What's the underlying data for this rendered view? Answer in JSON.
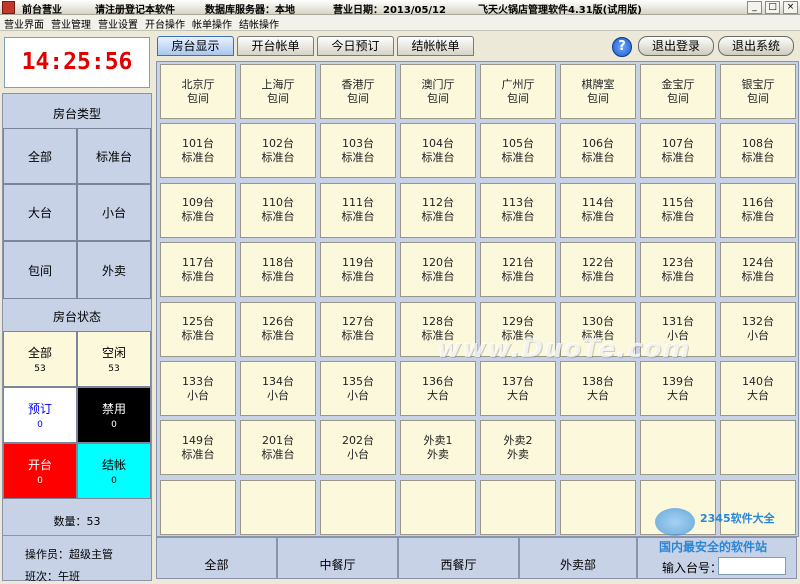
{
  "titlebar": {
    "module": "前台营业",
    "register": "请注册登记本软件",
    "db_server": "数据库服务器：本地",
    "business_date": "营业日期：2013/05/12",
    "app_title": "飞天火锅店管理软件4.31版(试用版)"
  },
  "menu": [
    "营业界面",
    "营业管理",
    "营业设置",
    "开台操作",
    "帐单操作",
    "结帐操作"
  ],
  "clock": "14:25:56",
  "room_types": {
    "heading": "房台类型",
    "items": [
      "全部",
      "标准台",
      "大台",
      "小台",
      "包间",
      "外卖"
    ]
  },
  "room_status": {
    "heading": "房台状态",
    "items": [
      {
        "label": "全部",
        "count": "53",
        "bg": "#fbf8dc",
        "fg": "#000000"
      },
      {
        "label": "空闲",
        "count": "53",
        "bg": "#fbf8dc",
        "fg": "#000000"
      },
      {
        "label": "预订",
        "count": "0",
        "bg": "#ffffff",
        "fg": "#0000ff"
      },
      {
        "label": "禁用",
        "count": "0",
        "bg": "#000000",
        "fg": "#ffffff"
      },
      {
        "label": "开台",
        "count": "0",
        "bg": "#ff0000",
        "fg": "#ffffff"
      },
      {
        "label": "结帐",
        "count": "0",
        "bg": "#00ffff",
        "fg": "#000000"
      }
    ],
    "quantity": "数量：53"
  },
  "operator": {
    "label": "操作员：超级主管",
    "shift": "班次：午班"
  },
  "tabs": [
    "房台显示",
    "开台帐单",
    "今日预订",
    "结帐帐单"
  ],
  "top_buttons": {
    "help": "?",
    "logout": "退出登录",
    "exit": "退出系统"
  },
  "tables": [
    [
      "北京厅",
      "包间"
    ],
    [
      "上海厅",
      "包间"
    ],
    [
      "香港厅",
      "包间"
    ],
    [
      "澳门厅",
      "包间"
    ],
    [
      "广州厅",
      "包间"
    ],
    [
      "棋牌室",
      "包间"
    ],
    [
      "金宝厅",
      "包间"
    ],
    [
      "银宝厅",
      "包间"
    ],
    [
      "101台",
      "标准台"
    ],
    [
      "102台",
      "标准台"
    ],
    [
      "103台",
      "标准台"
    ],
    [
      "104台",
      "标准台"
    ],
    [
      "105台",
      "标准台"
    ],
    [
      "106台",
      "标准台"
    ],
    [
      "107台",
      "标准台"
    ],
    [
      "108台",
      "标准台"
    ],
    [
      "109台",
      "标准台"
    ],
    [
      "110台",
      "标准台"
    ],
    [
      "111台",
      "标准台"
    ],
    [
      "112台",
      "标准台"
    ],
    [
      "113台",
      "标准台"
    ],
    [
      "114台",
      "标准台"
    ],
    [
      "115台",
      "标准台"
    ],
    [
      "116台",
      "标准台"
    ],
    [
      "117台",
      "标准台"
    ],
    [
      "118台",
      "标准台"
    ],
    [
      "119台",
      "标准台"
    ],
    [
      "120台",
      "标准台"
    ],
    [
      "121台",
      "标准台"
    ],
    [
      "122台",
      "标准台"
    ],
    [
      "123台",
      "标准台"
    ],
    [
      "124台",
      "标准台"
    ],
    [
      "125台",
      "标准台"
    ],
    [
      "126台",
      "标准台"
    ],
    [
      "127台",
      "标准台"
    ],
    [
      "128台",
      "标准台"
    ],
    [
      "129台",
      "标准台"
    ],
    [
      "130台",
      "标准台"
    ],
    [
      "131台",
      "小台"
    ],
    [
      "132台",
      "小台"
    ],
    [
      "133台",
      "小台"
    ],
    [
      "134台",
      "小台"
    ],
    [
      "135台",
      "小台"
    ],
    [
      "136台",
      "大台"
    ],
    [
      "137台",
      "大台"
    ],
    [
      "138台",
      "大台"
    ],
    [
      "139台",
      "大台"
    ],
    [
      "140台",
      "大台"
    ],
    [
      "149台",
      "标准台"
    ],
    [
      "201台",
      "标准台"
    ],
    [
      "202台",
      "小台"
    ],
    [
      "外卖1",
      "外卖"
    ],
    [
      "外卖2",
      "外卖"
    ],
    [
      "",
      ""
    ],
    [
      "",
      ""
    ],
    [
      "",
      ""
    ],
    [
      "",
      ""
    ],
    [
      "",
      ""
    ],
    [
      "",
      ""
    ],
    [
      "",
      ""
    ],
    [
      "",
      ""
    ],
    [
      "",
      ""
    ],
    [
      "",
      ""
    ],
    [
      "",
      ""
    ]
  ],
  "areas": [
    "全部",
    "中餐厅",
    "西餐厅",
    "外卖部"
  ],
  "entry": {
    "label": "输入台号：",
    "value": ""
  },
  "watermarks": {
    "main": "www.DuoTe.com",
    "site": "2345软件大全",
    "slogan": "国内最安全的软件站"
  }
}
